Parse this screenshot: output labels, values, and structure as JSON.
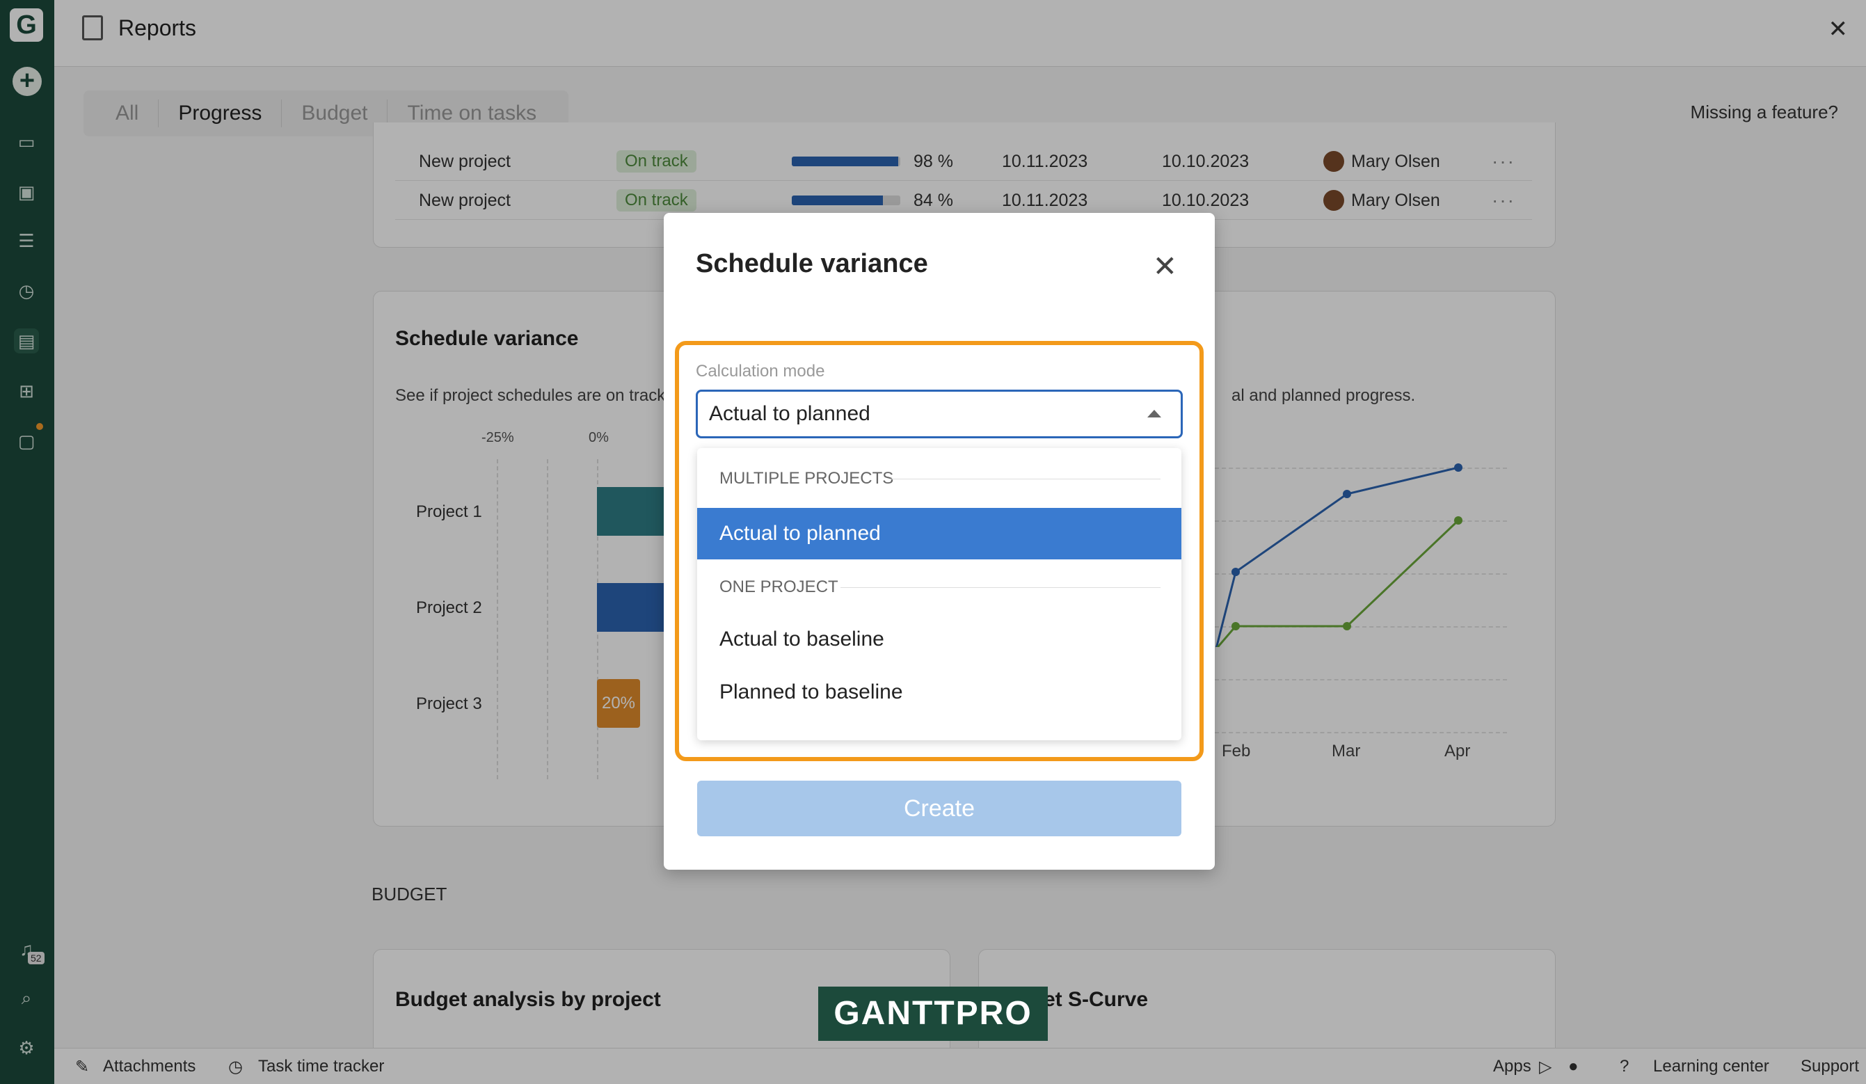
{
  "app": {
    "title": "Reports"
  },
  "tabs": [
    "All",
    "Progress",
    "Budget",
    "Time on tasks"
  ],
  "missing_feature": "Missing a feature?",
  "progress_rows": [
    {
      "name": "New project",
      "status": "On track",
      "progress": 98,
      "progress_label": "98 %",
      "date1": "10.11.2023",
      "date2": "10.10.2023",
      "owner": "Mary Olsen",
      "menu": "···"
    },
    {
      "name": "New project",
      "status": "On track",
      "progress": 84,
      "progress_label": "84 %",
      "date1": "10.11.2023",
      "date2": "10.10.2023",
      "owner": "Mary Olsen",
      "menu": "···"
    }
  ],
  "schedule_variance": {
    "title": "Schedule variance",
    "desc_left": "See if project schedules are on track",
    "desc_right": "al and planned progress.",
    "axis": [
      "-25%",
      "0%"
    ],
    "projects": [
      "Project 1",
      "Project 2",
      "Project 3"
    ],
    "project3_value": "20%",
    "months": [
      "Feb",
      "Mar",
      "Apr"
    ]
  },
  "budget_section": "BUDGET",
  "budget_cards": [
    "Budget analysis by project",
    "et S-Curve"
  ],
  "modal": {
    "title": "Schedule variance",
    "field_label": "Calculation mode",
    "selected": "Actual to planned",
    "groups": {
      "multiple": "MULTIPLE PROJECTS",
      "one": "ONE PROJECT"
    },
    "options_multiple": [
      "Actual to planned"
    ],
    "options_one": [
      "Actual to baseline",
      "Planned to baseline"
    ],
    "create_label": "Create"
  },
  "footer": {
    "attachments": "Attachments",
    "tracker": "Task time tracker",
    "apps": "Apps",
    "learning": "Learning center",
    "support": "Support"
  },
  "notifications_count": "52",
  "watermark": "GANTTPRO",
  "colors": {
    "accent": "#2b66b8",
    "highlight": "#f39a1a",
    "rail": "#1c4a3b"
  }
}
